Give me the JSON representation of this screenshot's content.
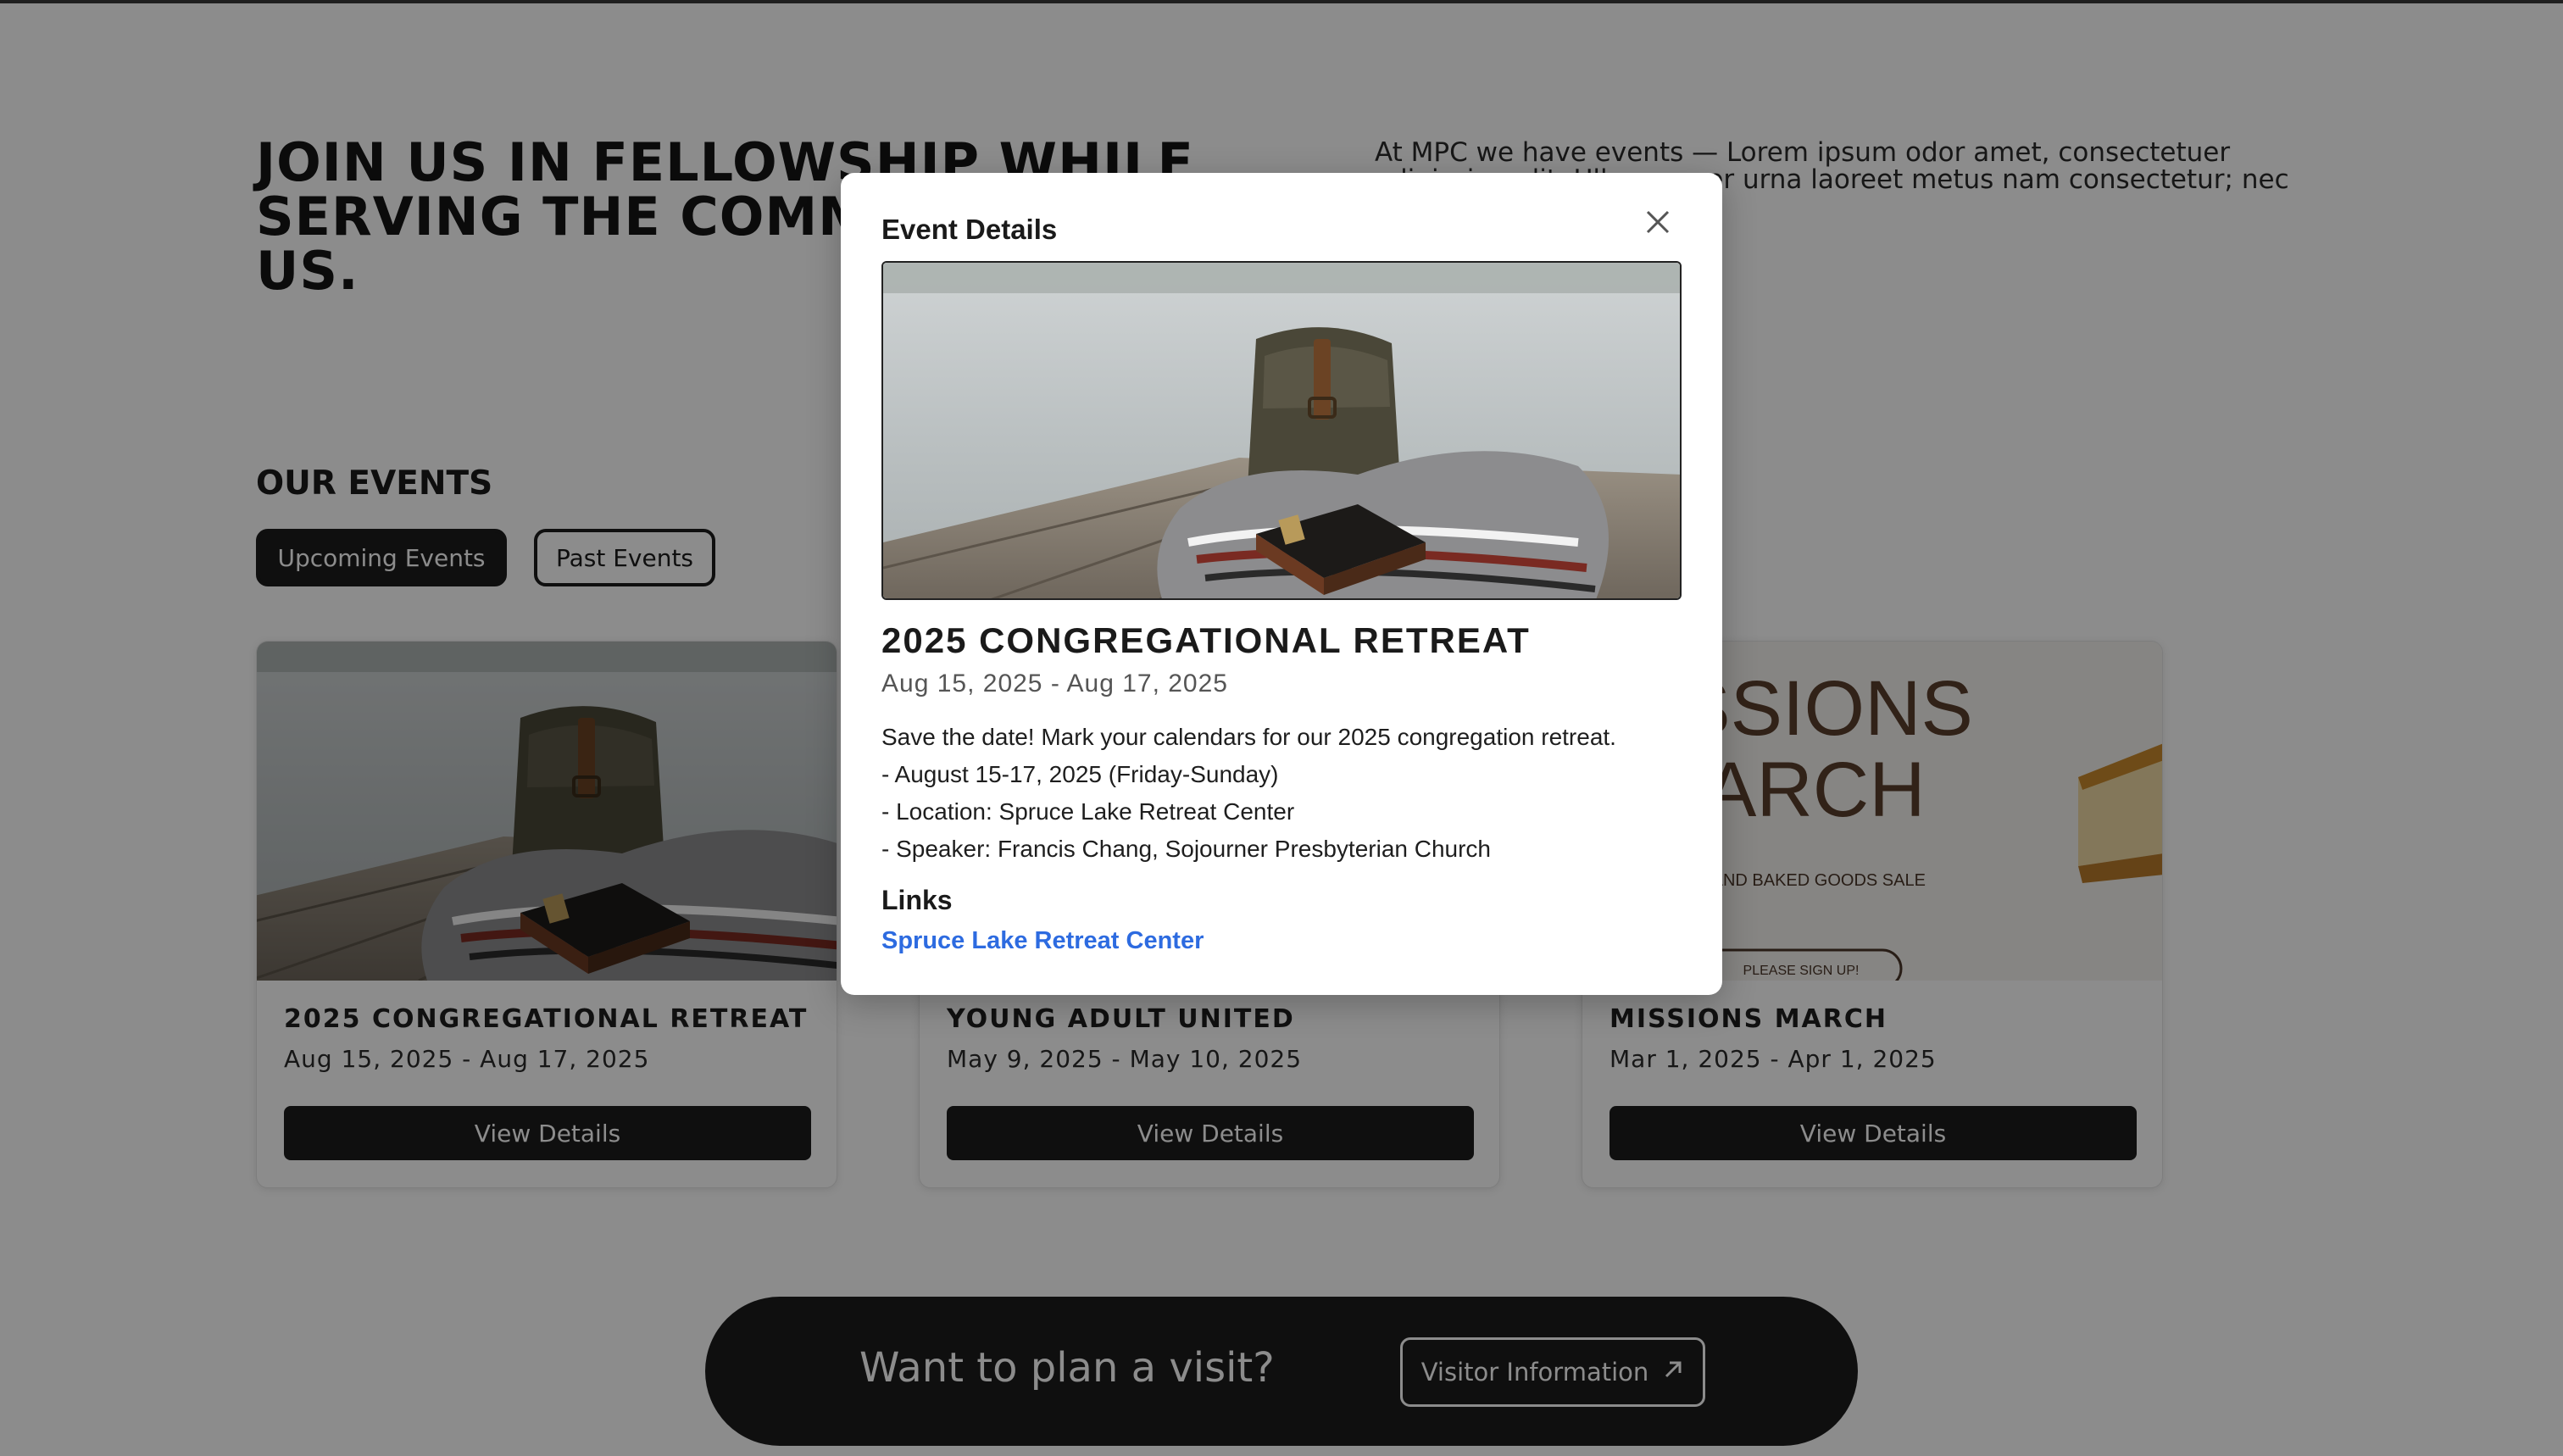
{
  "hero": {
    "heading": "JOIN US IN FELLOWSHIP WHILE SERVING THE COMMUNITY AROUND US.",
    "intro": "At MPC we have events — Lorem ipsum odor amet, consectetuer adipiscing elit. Ullamcorper urna laoreet metus nam consectetur; nec"
  },
  "events": {
    "title": "OUR EVENTS",
    "tabs": {
      "upcoming": "Upcoming Events",
      "past": "Past Events"
    },
    "cards": [
      {
        "title": "2025 CONGREGATIONAL RETREAT",
        "date": "Aug 15, 2025 - Aug 17, 2025",
        "button": "View Details"
      },
      {
        "title": "YOUNG ADULT UNITED",
        "date": "May 9, 2025 - May 10, 2025",
        "button": "View Details"
      },
      {
        "title": "MISSIONS MARCH",
        "date": "Mar 1, 2025 - Apr 1, 2025",
        "button": "View Details",
        "poster": {
          "line1": "MISSIONS",
          "line2": "MARCH",
          "sub": "COFFEE AND BAKED GOODS SALE",
          "signup": "PLEASE SIGN UP!"
        }
      }
    ]
  },
  "visit": {
    "text": "Want to plan a visit?",
    "button": "Visitor Information"
  },
  "modal": {
    "header": "Event Details",
    "title": "2025 CONGREGATIONAL RETREAT",
    "date": "Aug 15, 2025 - Aug 17, 2025",
    "description": [
      "Save the date! Mark your calendars for our 2025 congregation retreat.",
      "- August 15-17, 2025 (Friday-Sunday)",
      "- Location: Spruce Lake Retreat Center",
      "- Speaker: Francis Chang, Sojourner Presbyterian Church"
    ],
    "links_heading": "Links",
    "links": [
      "Spruce Lake Retreat Center"
    ]
  },
  "colors": {
    "dark": "#1c1c1c",
    "link": "#2d6be0",
    "overlay": "rgba(0,0,0,0.45)"
  },
  "icons": {
    "close": "close-icon",
    "external": "arrow-up-right-icon"
  }
}
